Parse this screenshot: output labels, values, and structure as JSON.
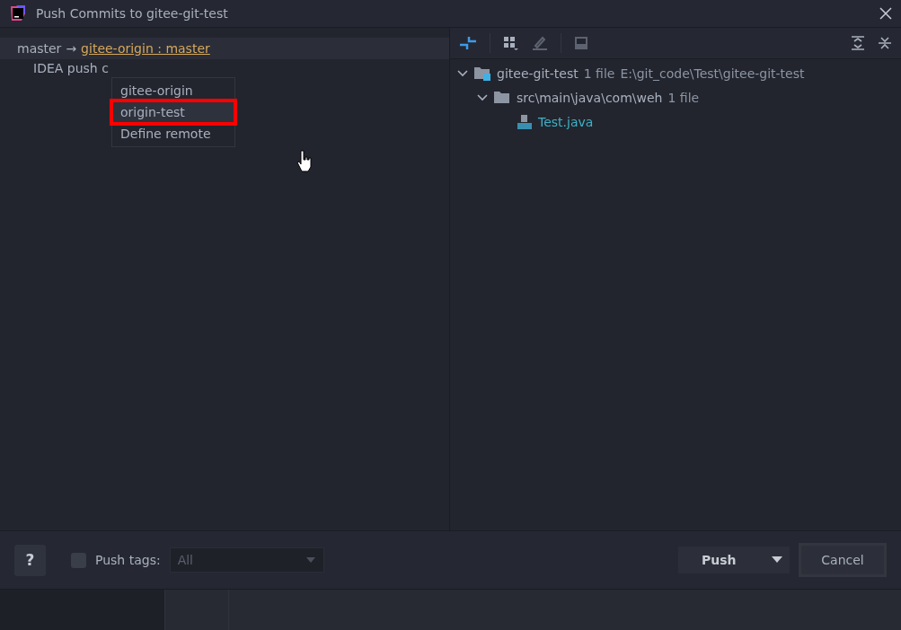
{
  "window": {
    "title": "Push Commits to gitee-git-test"
  },
  "push_spec": {
    "branch": "master",
    "arrow": "→",
    "target": "gitee-origin : master",
    "commit": "IDEA push c"
  },
  "remote_menu": {
    "items": [
      {
        "label": "gitee-origin",
        "selected": false
      },
      {
        "label": "origin-test",
        "selected": true
      },
      {
        "label": "Define remote",
        "selected": false
      }
    ]
  },
  "changes_tree": [
    {
      "kind": "repo",
      "name": "gitee-git-test",
      "count": "1 file",
      "path": "E:\\git_code\\Test\\gitee-git-test",
      "expanded": true,
      "children": [
        {
          "kind": "folder",
          "name": "src\\main\\java\\com\\weh",
          "count": "1 file",
          "expanded": true,
          "children": [
            {
              "kind": "file",
              "name": "Test.java"
            }
          ]
        }
      ]
    }
  ],
  "footer": {
    "help": "?",
    "push_tags": {
      "label": "Push tags:",
      "checked": false,
      "value": "All",
      "disabled": true
    },
    "buttons": [
      "Push",
      "Cancel"
    ]
  }
}
